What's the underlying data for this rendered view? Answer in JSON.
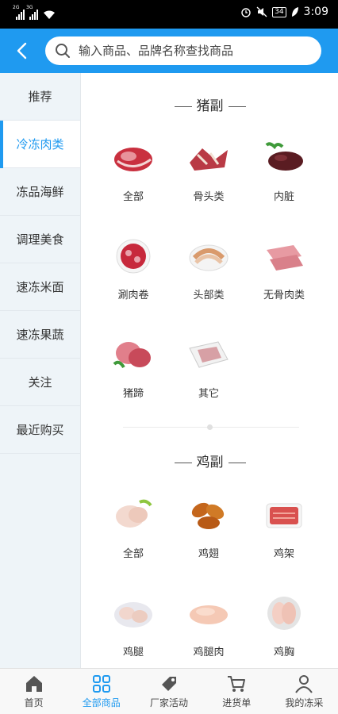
{
  "status_bar": {
    "net1": "2G",
    "net2": "3G",
    "battery": "34",
    "time": "3:09"
  },
  "search": {
    "placeholder": "输入商品、品牌名称查找商品"
  },
  "sidebar": {
    "items": [
      {
        "label": "推荐",
        "active": false
      },
      {
        "label": "冷冻肉类",
        "active": true
      },
      {
        "label": "冻品海鲜",
        "active": false
      },
      {
        "label": "调理美食",
        "active": false
      },
      {
        "label": "速冻米面",
        "active": false
      },
      {
        "label": "速冻果蔬",
        "active": false
      },
      {
        "label": "关注",
        "active": false
      },
      {
        "label": "最近购买",
        "active": false
      }
    ]
  },
  "sections": [
    {
      "title": "猪副",
      "items": [
        {
          "label": "全部",
          "icon": "pork-cuts-icon"
        },
        {
          "label": "骨头类",
          "icon": "pork-bones-icon"
        },
        {
          "label": "内脏",
          "icon": "pork-offal-icon"
        },
        {
          "label": "涮肉卷",
          "icon": "meat-roll-icon"
        },
        {
          "label": "头部类",
          "icon": "pork-head-icon"
        },
        {
          "label": "无骨肉类",
          "icon": "boneless-meat-icon"
        },
        {
          "label": "猪蹄",
          "icon": "trotter-icon"
        },
        {
          "label": "其它",
          "icon": "pork-other-icon"
        }
      ]
    },
    {
      "title": "鸡副",
      "items": [
        {
          "label": "全部",
          "icon": "chicken-all-icon"
        },
        {
          "label": "鸡翅",
          "icon": "chicken-wing-icon"
        },
        {
          "label": "鸡架",
          "icon": "chicken-frame-icon"
        },
        {
          "label": "鸡腿",
          "icon": "chicken-leg-icon"
        },
        {
          "label": "鸡腿肉",
          "icon": "chicken-thigh-meat-icon"
        },
        {
          "label": "鸡胸",
          "icon": "chicken-breast-icon"
        }
      ]
    }
  ],
  "bottom_nav": [
    {
      "label": "首页",
      "icon": "home-icon",
      "active": false
    },
    {
      "label": "全部商品",
      "icon": "grid-icon",
      "active": true
    },
    {
      "label": "厂家活动",
      "icon": "tag-icon",
      "active": false
    },
    {
      "label": "进货单",
      "icon": "cart-icon",
      "active": false
    },
    {
      "label": "我的冻采",
      "icon": "user-icon",
      "active": false
    }
  ],
  "colors": {
    "accent": "#1f9af0",
    "sidebar_bg": "#eef4f8"
  }
}
